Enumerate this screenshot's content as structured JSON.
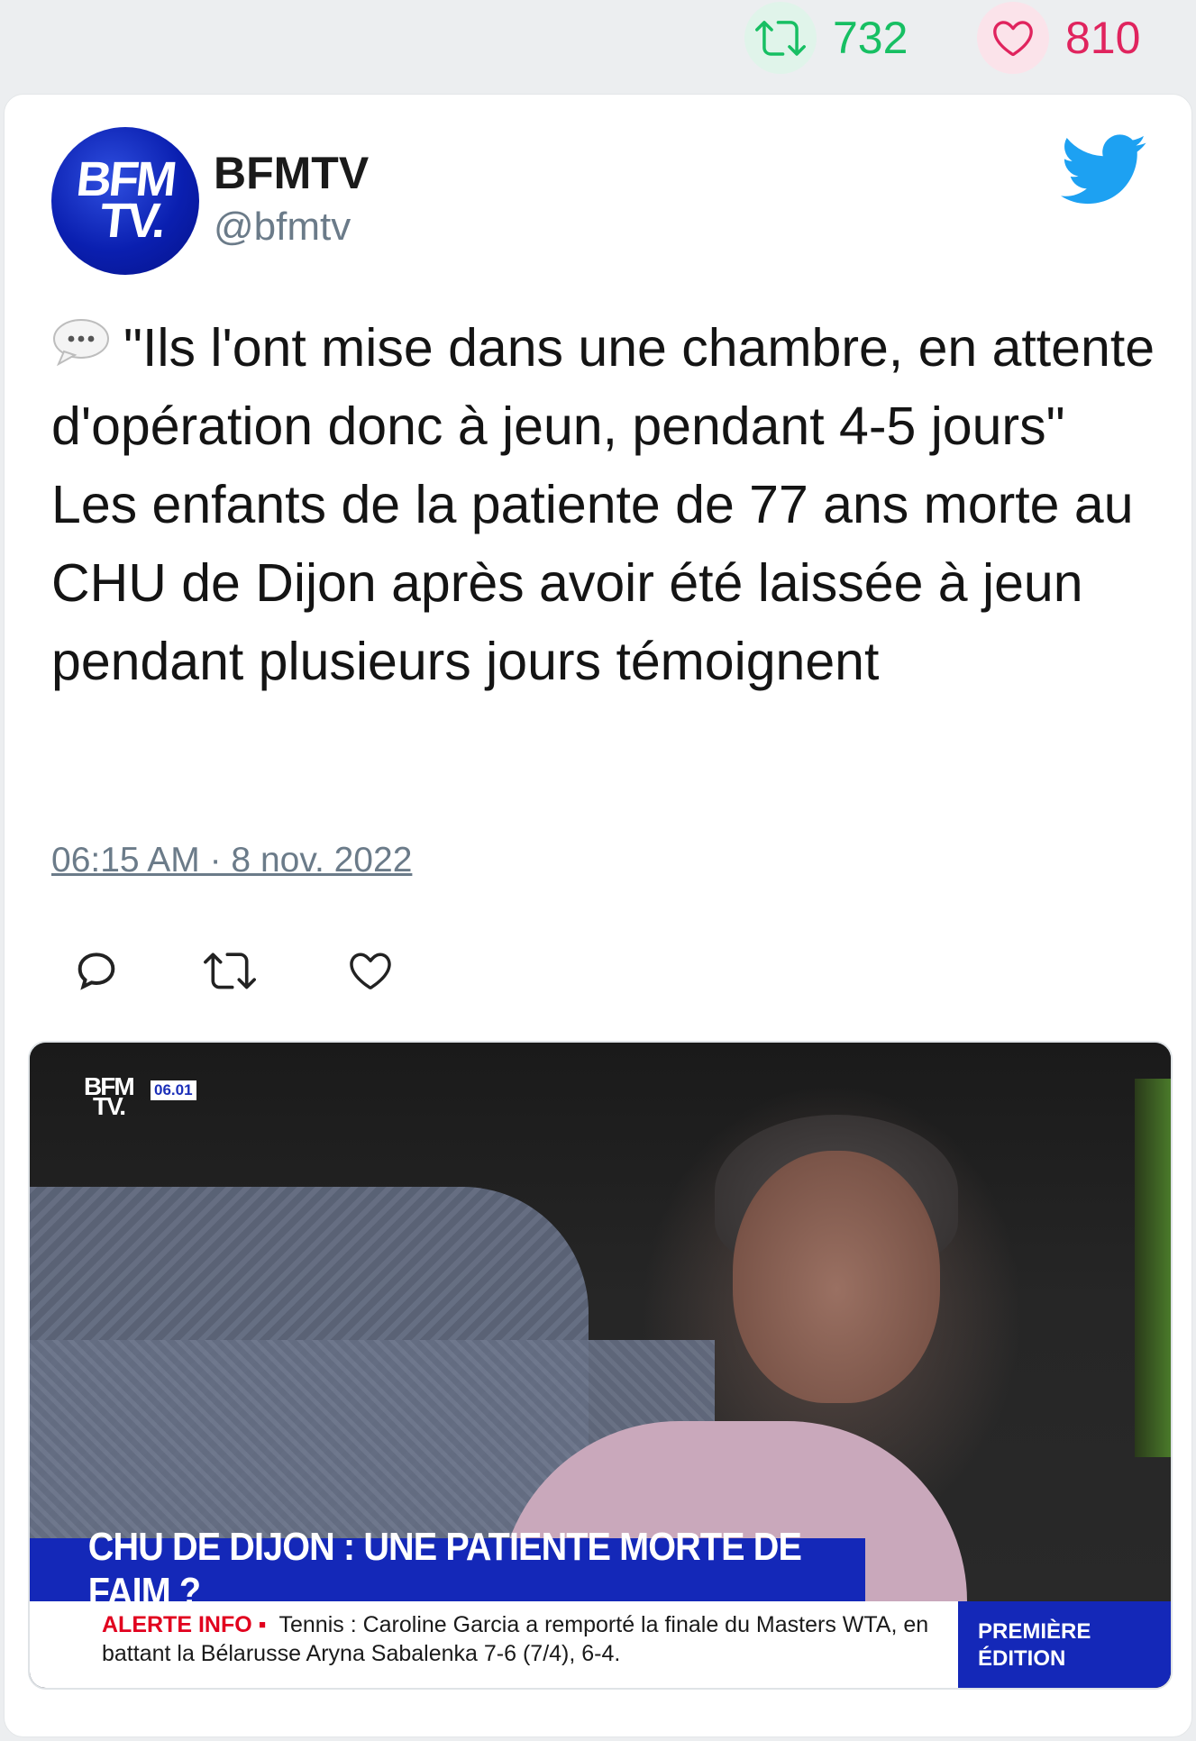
{
  "stats": {
    "retweets": "732",
    "likes": "810"
  },
  "author": {
    "name": "BFMTV",
    "handle": "@bfmtv",
    "avatar_line1": "BFM",
    "avatar_line2": "TV."
  },
  "tweet": {
    "text": "\"Ils l'ont mise dans une chambre, en attente d'opération donc à jeun, pendant 4-5 jours\" Les enfants de la patiente de 77 ans morte au CHU de Dijon après avoir été laissée à jeun pendant plusieurs jours témoignent",
    "timestamp": "06:15 AM · 8 nov. 2022"
  },
  "media": {
    "logo_line1": "BFM",
    "logo_line2": "TV.",
    "clock": "06.01",
    "headline": "CHU DE DIJON : UNE PATIENTE MORTE DE FAIM ?",
    "ticker_label": "ALERTE INFO ▪",
    "ticker_text": "Tennis : Caroline Garcia a remporté la finale du Masters WTA, en battant la Bélarusse Aryna Sabalenka 7-6 (7/4), 6-4.",
    "edition_line1": "PREMIÈRE",
    "edition_line2": "ÉDITION"
  },
  "icons": {
    "retweet": "retweet-icon",
    "like": "heart-icon",
    "reply": "reply-icon",
    "twitter": "twitter-bird-icon",
    "speech": "speech-balloon-icon"
  },
  "colors": {
    "retweet_green": "#17bf63",
    "like_red": "#e0245e",
    "twitter_blue": "#1da1f2",
    "bfm_blue": "#1428b8"
  }
}
